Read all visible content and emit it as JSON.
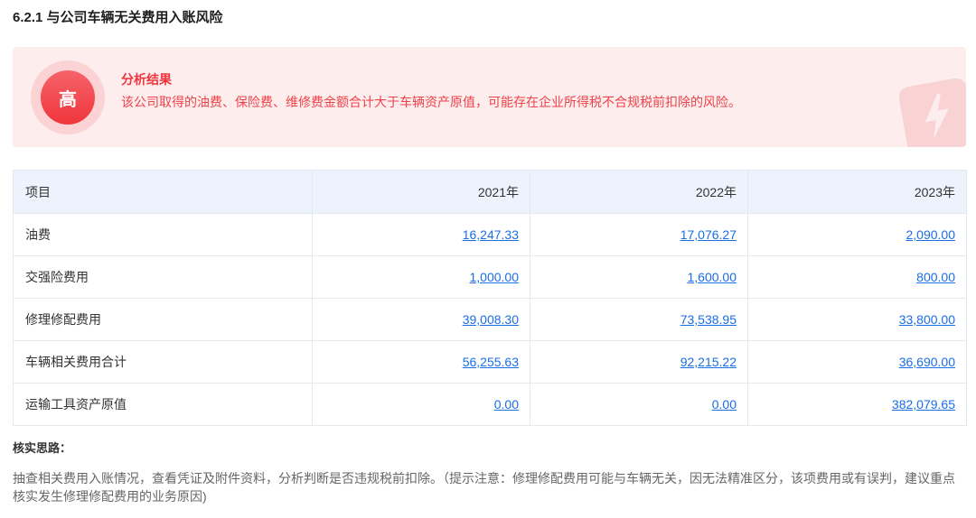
{
  "section": {
    "title": "6.2.1 与公司车辆无关费用入账风险"
  },
  "alert": {
    "risk_level": "高",
    "heading": "分析结果",
    "message": "该公司取得的油费、保险费、维修费金额合计大于车辆资产原值，可能存在企业所得税不合规税前扣除的风险。",
    "decor_icon": "lightning-icon"
  },
  "table": {
    "headers": [
      "项目",
      "2021年",
      "2022年",
      "2023年"
    ],
    "rows": [
      {
        "label": "油费",
        "values": [
          "16,247.33",
          "17,076.27",
          "2,090.00"
        ]
      },
      {
        "label": "交强险费用",
        "values": [
          "1,000.00",
          "1,600.00",
          "800.00"
        ]
      },
      {
        "label": "修理修配费用",
        "values": [
          "39,008.30",
          "73,538.95",
          "33,800.00"
        ]
      },
      {
        "label": "车辆相关费用合计",
        "values": [
          "56,255.63",
          "92,215.22",
          "36,690.00"
        ]
      },
      {
        "label": "运输工具资产原值",
        "values": [
          "0.00",
          "0.00",
          "382,079.65"
        ]
      }
    ]
  },
  "verification": {
    "heading": "核实思路：",
    "text": "抽查相关费用入账情况，查看凭证及附件资料，分析判断是否违规税前扣除。（提示注意：修理修配费用可能与车辆无关，因无法精准区分，该项费用或有误判，建议重点核实发生修理修配费用的业务原因)"
  },
  "colors": {
    "risk_red": "#f0353d",
    "alert_background": "#fdeded",
    "link_blue": "#1a6ee6",
    "table_header_background": "#edf3fc",
    "border": "#e4e8ef"
  }
}
